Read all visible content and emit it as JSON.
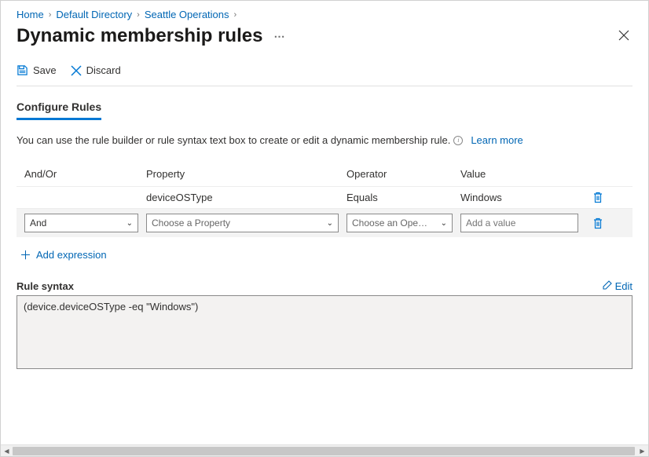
{
  "breadcrumb": {
    "items": [
      "Home",
      "Default Directory",
      "Seattle Operations"
    ]
  },
  "page": {
    "title": "Dynamic membership rules"
  },
  "toolbar": {
    "save": "Save",
    "discard": "Discard"
  },
  "tabs": {
    "configure": "Configure Rules"
  },
  "help": {
    "text": "You can use the rule builder or rule syntax text box to create or edit a dynamic membership rule.",
    "learn_more": "Learn more"
  },
  "table": {
    "headers": {
      "andor": "And/Or",
      "property": "Property",
      "operator": "Operator",
      "value": "Value"
    },
    "rows": [
      {
        "andor": "",
        "property": "deviceOSType",
        "operator": "Equals",
        "value": "Windows"
      }
    ],
    "editing": {
      "andor_selected": "And",
      "property_placeholder": "Choose a Property",
      "operator_placeholder": "Choose an Ope…",
      "value_placeholder": "Add a value"
    }
  },
  "add_expression": "Add expression",
  "syntax": {
    "label": "Rule syntax",
    "edit": "Edit",
    "text": "(device.deviceOSType -eq \"Windows\")"
  }
}
